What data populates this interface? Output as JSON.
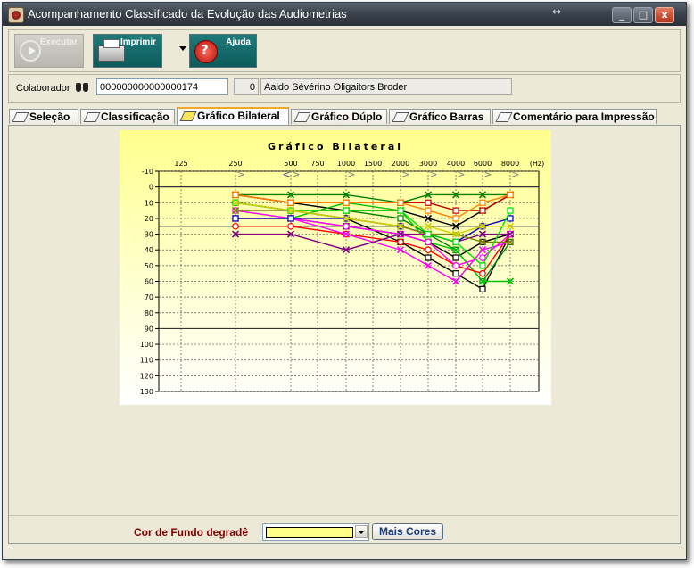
{
  "window": {
    "title": "Acompanhamento Classificado da Evolução das Audiometrias",
    "resize_hint": "↔",
    "minimize": "_",
    "maximize": "□",
    "close": "x"
  },
  "toolbar": {
    "executar_label": "Executar",
    "imprimir_label": "Imprimir",
    "ajuda_label": "Ajuda"
  },
  "colaborador": {
    "label": "Colaborador",
    "id": "000000000000000174",
    "number": "0",
    "name": "Aaldo Sévérino Oligaitors Broder"
  },
  "tabs": [
    "Seleção",
    "Classificação",
    "Gráfico Bilateral",
    "Gráfico Dúplo",
    "Gráfico Barras",
    "Comentário para Impressão"
  ],
  "active_tab": 2,
  "bottom": {
    "bg_label": "Cor de Fundo degradê",
    "bg_color": "#ffff88",
    "more_colors_label": "Mais Cores"
  },
  "chart_data": {
    "type": "line",
    "title": "Gráfico Bilateral",
    "x_unit": "(Hz)",
    "x_ticks": [
      "125",
      "250",
      "500",
      "750",
      "1000",
      "1500",
      "2000",
      "3000",
      "4000",
      "6000",
      "8000"
    ],
    "y_ticks": [
      -10,
      0,
      10,
      20,
      30,
      40,
      50,
      60,
      70,
      80,
      90,
      100,
      110,
      120,
      130
    ],
    "ylim": [
      -10,
      130
    ],
    "y_inverted": true,
    "grid": true,
    "x_categories": [
      "250",
      "500",
      "1000",
      "2000",
      "3000",
      "4000",
      "6000",
      "8000"
    ],
    "series": [
      {
        "color": "#000000",
        "marker": "square",
        "values": [
          10,
          15,
          20,
          35,
          45,
          55,
          65,
          30
        ]
      },
      {
        "color": "#000000",
        "marker": "x",
        "values": [
          5,
          10,
          15,
          15,
          20,
          25,
          15,
          5
        ]
      },
      {
        "color": "#000000",
        "marker": "square",
        "values": [
          20,
          20,
          25,
          30,
          35,
          45,
          35,
          30
        ]
      },
      {
        "color": "#008000",
        "marker": "x",
        "values": [
          5,
          5,
          5,
          10,
          5,
          5,
          5,
          5
        ]
      },
      {
        "color": "#008000",
        "marker": "square",
        "values": [
          10,
          15,
          15,
          20,
          30,
          40,
          60,
          35
        ]
      },
      {
        "color": "#00c000",
        "marker": "x",
        "values": [
          15,
          20,
          10,
          15,
          35,
          40,
          60,
          60
        ]
      },
      {
        "color": "#ff0000",
        "marker": "o",
        "values": [
          25,
          25,
          30,
          35,
          40,
          50,
          55,
          30
        ]
      },
      {
        "color": "#c00000",
        "marker": "square",
        "values": [
          5,
          10,
          10,
          10,
          10,
          15,
          15,
          5
        ]
      },
      {
        "color": "#ff00ff",
        "marker": "o",
        "values": [
          15,
          20,
          25,
          30,
          35,
          50,
          45,
          30
        ]
      },
      {
        "color": "#ff00ff",
        "marker": "x",
        "values": [
          20,
          20,
          30,
          40,
          50,
          60,
          40,
          35
        ]
      },
      {
        "color": "#800080",
        "marker": "x",
        "values": [
          30,
          30,
          40,
          30,
          30,
          35,
          30,
          30
        ]
      },
      {
        "color": "#0000c0",
        "marker": "square",
        "values": [
          20,
          20,
          20,
          25,
          30,
          35,
          25,
          20
        ]
      },
      {
        "color": "#ff8000",
        "marker": "square",
        "values": [
          5,
          10,
          10,
          10,
          15,
          20,
          10,
          5
        ]
      },
      {
        "color": "#808000",
        "marker": "x",
        "values": [
          15,
          15,
          20,
          25,
          30,
          30,
          35,
          35
        ]
      },
      {
        "color": "#00e000",
        "marker": "square",
        "values": [
          10,
          15,
          15,
          15,
          30,
          35,
          50,
          15
        ]
      },
      {
        "color": "#d0d000",
        "marker": "x",
        "values": [
          10,
          15,
          20,
          25,
          25,
          30,
          25,
          25
        ]
      }
    ],
    "top_markers": [
      {
        "x": "250",
        "symbol": ">",
        "color": "#808080"
      },
      {
        "x": "500",
        "symbol": ">",
        "color": "#808080"
      },
      {
        "x": "500",
        "symbol": "<",
        "color": "#4040a0"
      },
      {
        "x": "1000",
        "symbol": ">",
        "color": "#808080"
      },
      {
        "x": "2000",
        "symbol": ">",
        "color": "#808080"
      },
      {
        "x": "3000",
        "symbol": ">",
        "color": "#808080"
      },
      {
        "x": "4000",
        "symbol": ">",
        "color": "#808080"
      },
      {
        "x": "6000",
        "symbol": ">",
        "color": "#808080"
      },
      {
        "x": "8000",
        "symbol": ">",
        "color": "#808080"
      }
    ]
  }
}
